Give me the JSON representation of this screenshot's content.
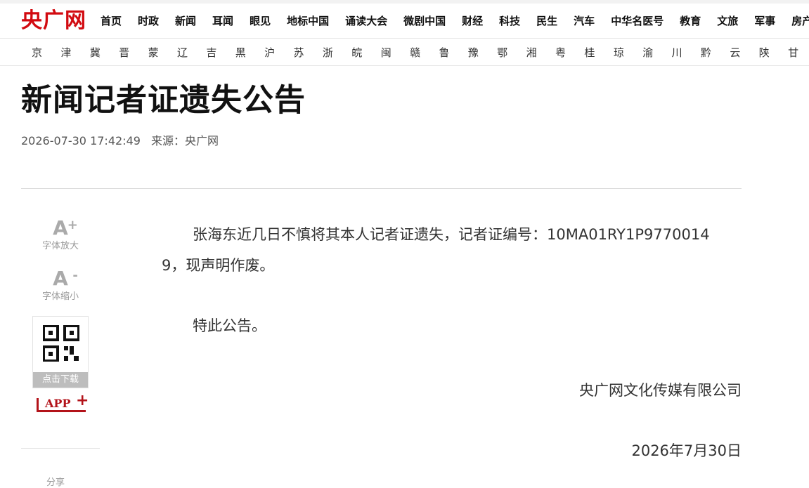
{
  "brand": {
    "logo_text": "央广网",
    "color": "#d20a10"
  },
  "nav_main": [
    "首页",
    "时政",
    "新闻",
    "耳闻",
    "眼见",
    "地标中国",
    "诵读大会",
    "微剧中国",
    "财经",
    "科技",
    "民生",
    "汽车",
    "中华名医号",
    "教育",
    "文旅",
    "军事",
    "房产"
  ],
  "nav_regions": [
    "京",
    "津",
    "冀",
    "晋",
    "蒙",
    "辽",
    "吉",
    "黑",
    "沪",
    "苏",
    "浙",
    "皖",
    "闽",
    "赣",
    "鲁",
    "豫",
    "鄂",
    "湘",
    "粤",
    "桂",
    "琼",
    "渝",
    "川",
    "黔",
    "云",
    "陕",
    "甘"
  ],
  "article": {
    "title": "新闻记者证遗失公告",
    "datetime": "2026-07-30 17:42:49",
    "source": "来源：央广网",
    "paragraph1": "张海东近几日不慎将其本人记者证遗失，记者证编号：10MA01RY1P97700149，现声明作废。",
    "paragraph2": "特此公告。",
    "signature": "央广网文化传媒有限公司",
    "date": "2026年7月30日"
  },
  "tools": {
    "enlarge_glyph": "A",
    "enlarge_sup": "+",
    "enlarge_label": "字体放大",
    "shrink_glyph": "A",
    "shrink_sup": "-",
    "shrink_label": "字体缩小",
    "qr_label": "点击下载",
    "app_text": "APP",
    "app_plus": "+",
    "more_label": "分享"
  },
  "colors": {
    "accent": "#d20a10",
    "app_red": "#b3131a",
    "muted": "#999999"
  }
}
